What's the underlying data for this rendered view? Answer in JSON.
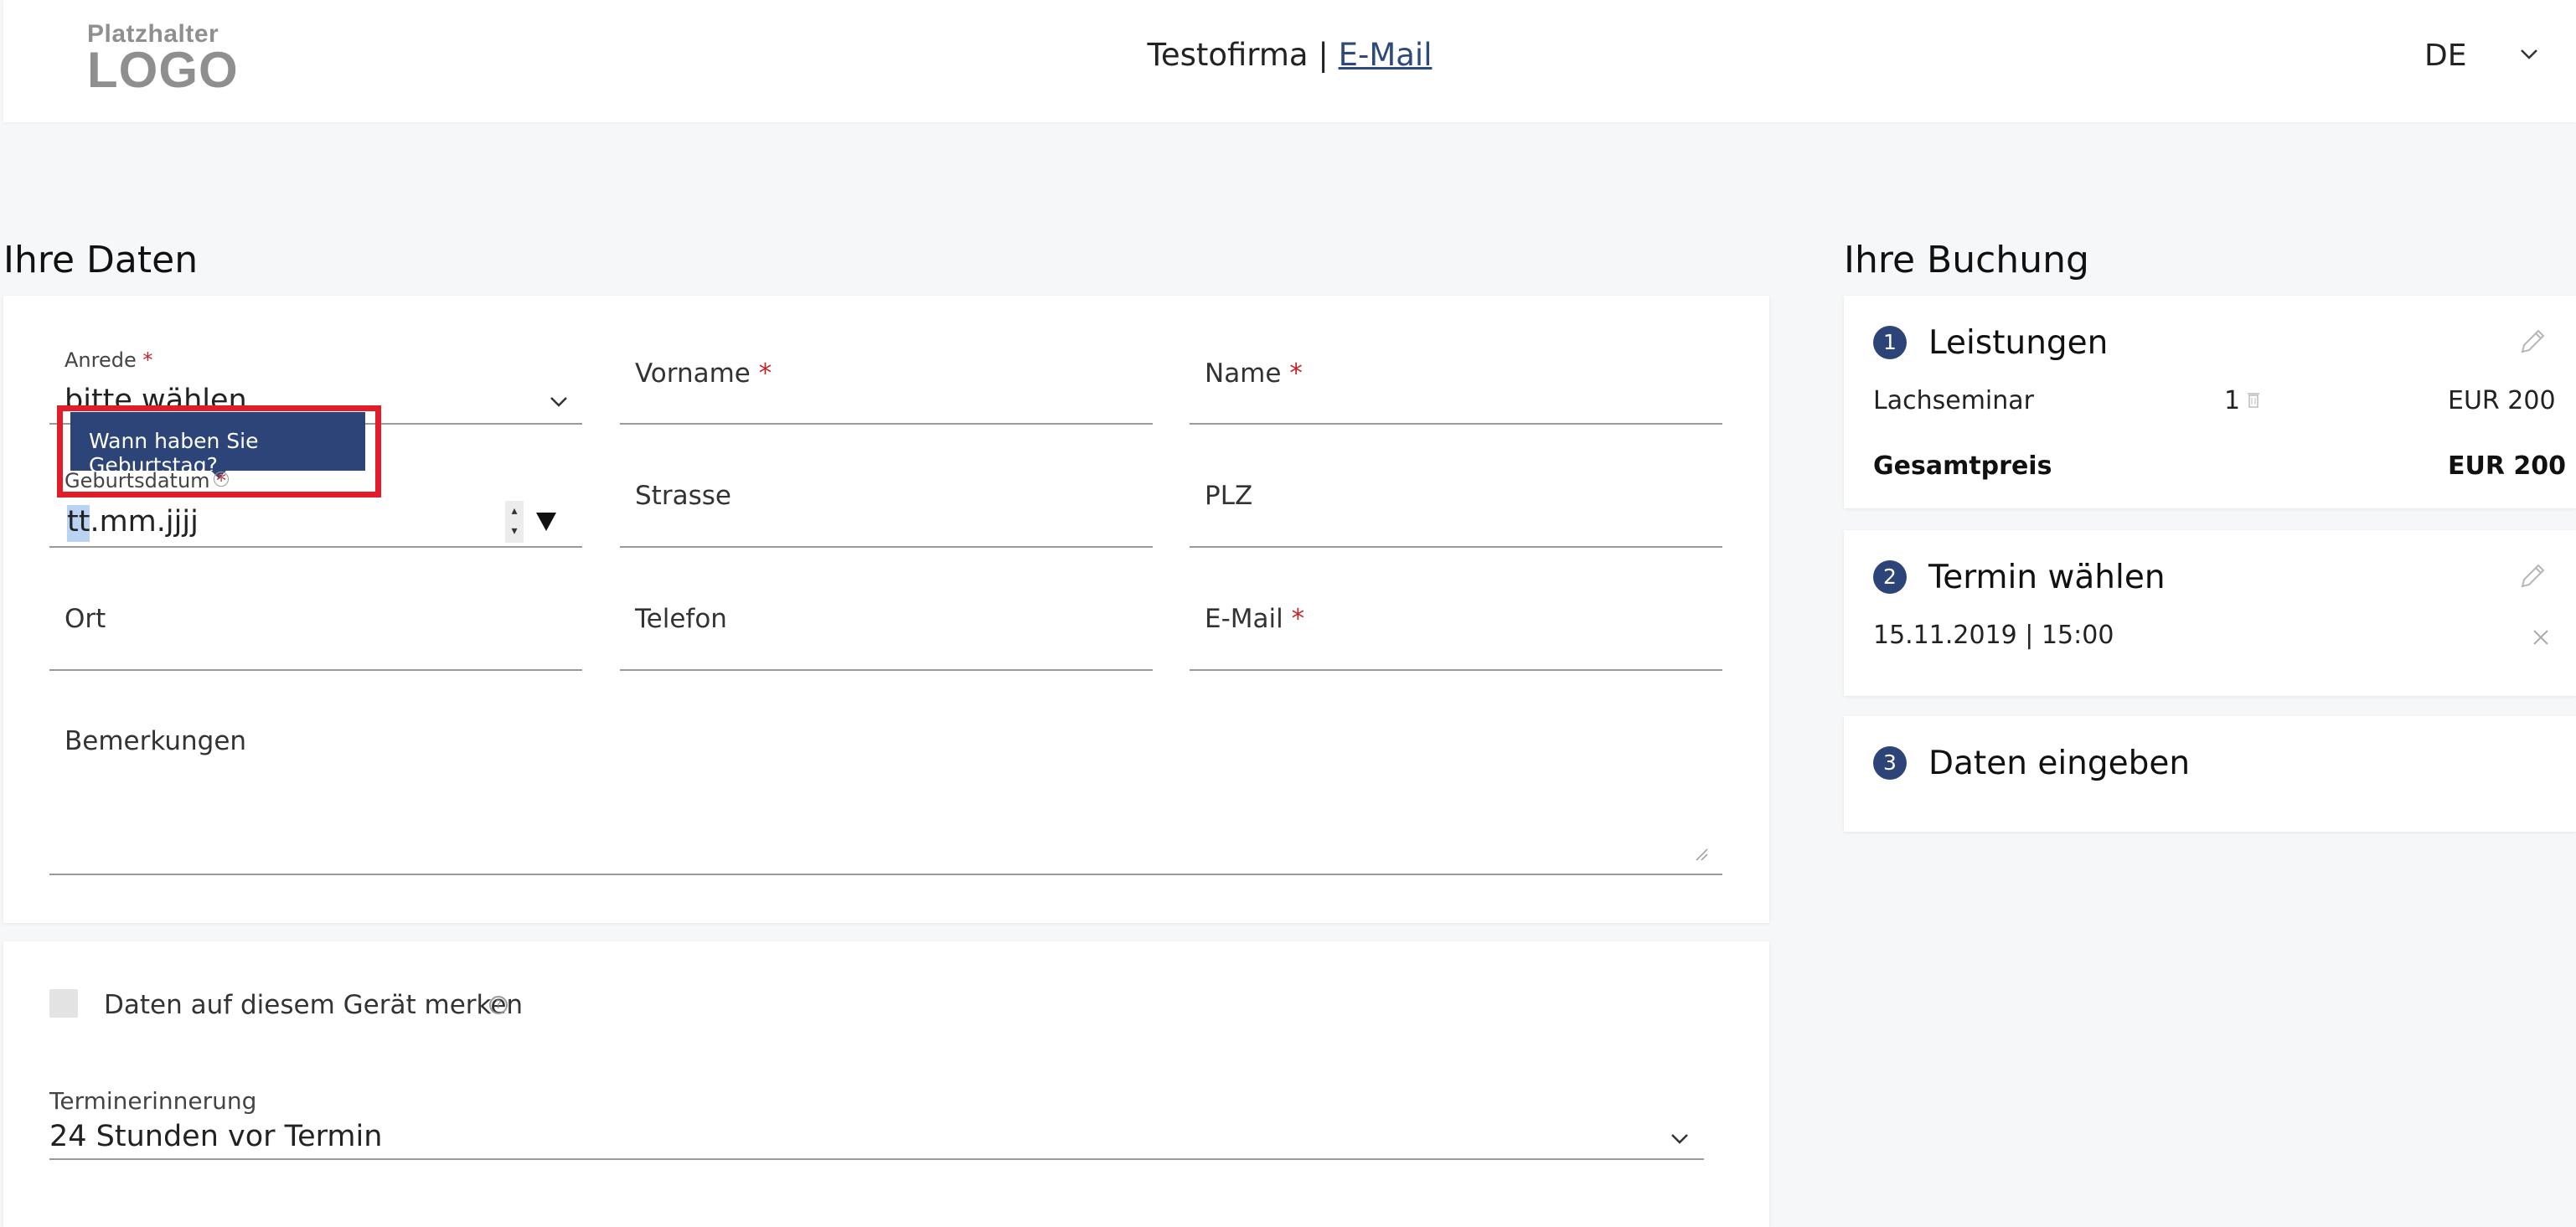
{
  "header": {
    "logo_line1": "Platzhalter",
    "logo_line2": "LOGO",
    "company": "Testofirma",
    "separator": " | ",
    "email_link": "E-Mail",
    "language": "DE"
  },
  "form": {
    "title": "Ihre Daten",
    "anrede_label": "Anrede",
    "anrede_value": "bitte wählen",
    "vorname_label": "Vorname",
    "name_label": "Name",
    "tooltip": "Wann haben Sie Geburtstag?",
    "geburtsdatum_label": "Geburtsdatum",
    "date_seg_day": "tt",
    "date_rest": ".mm.jjjj",
    "strasse_label": "Strasse",
    "plz_label": "PLZ",
    "ort_label": "Ort",
    "telefon_label": "Telefon",
    "email_label": "E-Mail",
    "bemerkungen_label": "Bemerkungen",
    "required_mark": "*"
  },
  "options": {
    "remember_label": "Daten auf diesem Gerät merken",
    "reminder_label": "Terminerinnerung",
    "reminder_value": "24 Stunden vor Termin"
  },
  "booking": {
    "title": "Ihre Buchung",
    "steps": [
      {
        "num": "1",
        "title": "Leistungen"
      },
      {
        "num": "2",
        "title": "Termin wählen"
      },
      {
        "num": "3",
        "title": "Daten eingeben"
      }
    ],
    "item_name": "Lachseminar",
    "item_qty": "1",
    "item_price": "EUR 200",
    "total_label": "Gesamtpreis",
    "total_price": "EUR 200",
    "appointment": "15.11.2019 | 15:00"
  },
  "colors": {
    "accent": "#2d4478",
    "required": "#c0262d",
    "highlight": "#e11d2a"
  }
}
